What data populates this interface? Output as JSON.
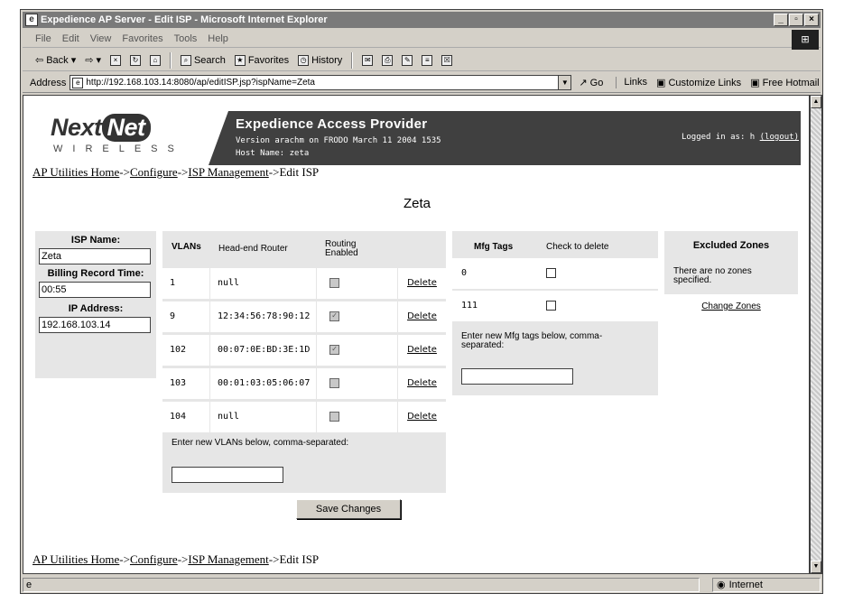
{
  "browser": {
    "title": "Expedience AP Server - Edit ISP - Microsoft Internet Explorer",
    "menu": [
      "File",
      "Edit",
      "View",
      "Favorites",
      "Tools",
      "Help"
    ],
    "toolbar": {
      "back": "Back",
      "search": "Search",
      "favorites": "Favorites",
      "history": "History"
    },
    "address_label": "Address",
    "url": "http://192.168.103.14:8080/ap/editISP.jsp?ispName=Zeta",
    "go": "Go",
    "links_label": "Links",
    "links": [
      "Customize Links",
      "Free Hotmail"
    ],
    "status_zone": "Internet"
  },
  "banner": {
    "logo_main_a": "Next",
    "logo_main_b": "Net",
    "logo_sub": "WIRELESS",
    "title": "Expedience Access Provider",
    "version": "Version arachm on FRODO March 11 2004 1535",
    "host": "Host Name: zeta",
    "logged_in": "Logged in as: h",
    "logout": "(logout)"
  },
  "breadcrumb": {
    "home": "AP Utilities Home",
    "configure": "Configure",
    "isp_mgmt": "ISP Management",
    "current": "Edit ISP",
    "sep": "->"
  },
  "isp_heading": "Zeta",
  "isp_panel": {
    "name_label": "ISP Name:",
    "name_value": "Zeta",
    "billing_label": "Billing Record Time:",
    "billing_value": "00:55",
    "ip_label": "IP Address:",
    "ip_value": "192.168.103.14"
  },
  "vlan_panel": {
    "headers": [
      "VLANs",
      "Head-end Router",
      "Routing Enabled"
    ],
    "delete_label": "Delete",
    "rows": [
      {
        "vlan": "1",
        "router": "null",
        "routing": false
      },
      {
        "vlan": "9",
        "router": "12:34:56:78:90:12",
        "routing": true
      },
      {
        "vlan": "102",
        "router": "00:07:0E:BD:3E:1D",
        "routing": true
      },
      {
        "vlan": "103",
        "router": "00:01:03:05:06:07",
        "routing": false
      },
      {
        "vlan": "104",
        "router": "null",
        "routing": false
      }
    ],
    "prompt": "Enter new VLANs below, comma-separated:"
  },
  "mfg_panel": {
    "headers": [
      "Mfg Tags",
      "Check to delete"
    ],
    "rows": [
      {
        "tag": "0"
      },
      {
        "tag": "111"
      }
    ],
    "prompt": "Enter new Mfg tags below, comma-separated:"
  },
  "zones_panel": {
    "heading": "Excluded Zones",
    "text": "There are no zones specified.",
    "link": "Change Zones"
  },
  "save_button": "Save Changes"
}
